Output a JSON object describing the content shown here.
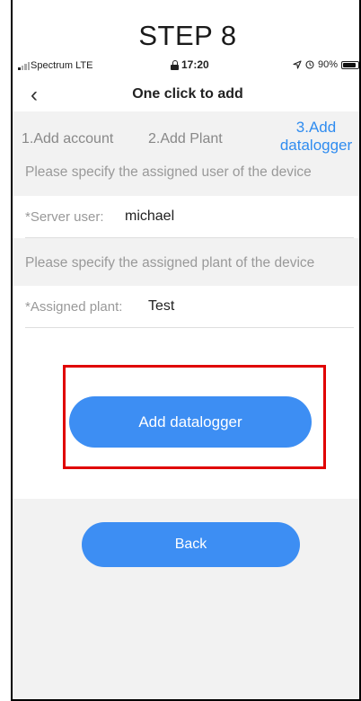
{
  "overlay": {
    "step_title": "STEP 8"
  },
  "status_bar": {
    "carrier": "Spectrum  LTE",
    "time": "17:20",
    "location_icon": "location-arrow-icon",
    "alarm_icon": "alarm-icon",
    "battery_percent": "90%",
    "battery_level": 0.9
  },
  "nav": {
    "back_icon": "chevron-left-icon",
    "back_glyph": "‹",
    "title": "One click to add"
  },
  "steps": {
    "items": [
      {
        "label": "1.Add account",
        "active": false
      },
      {
        "label": "2.Add Plant",
        "active": false
      },
      {
        "label_line1": "3.Add",
        "label_line2": "datalogger",
        "active": true
      }
    ],
    "active_color": "#2f8cf0"
  },
  "form": {
    "user_hint": "Please specify the assigned user of the device",
    "user_label": "*Server user:",
    "user_value": "michael",
    "plant_hint": "Please specify the assigned plant of the device",
    "plant_label": "*Assigned plant:",
    "plant_value": "Test"
  },
  "actions": {
    "add_label": "Add datalogger",
    "back_label": "Back",
    "button_color": "#3d8ef3",
    "highlight_color": "#e00000"
  }
}
